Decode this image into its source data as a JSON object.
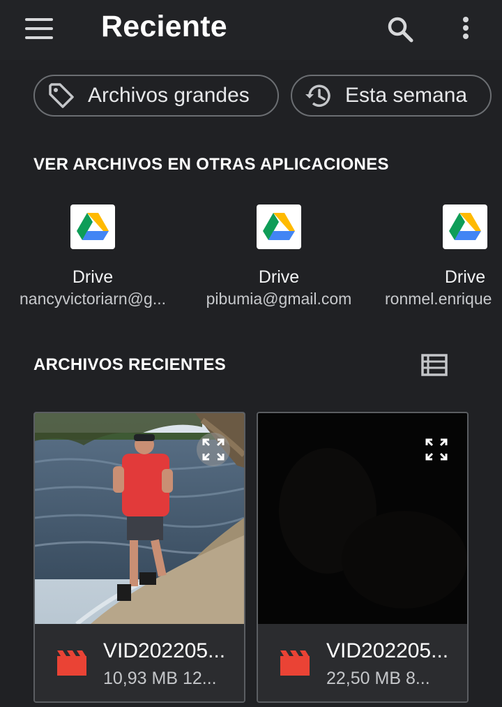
{
  "appbar": {
    "title": "Reciente",
    "menu_icon": "hamburger-menu-icon",
    "search_icon": "search-icon",
    "more_icon": "more-vertical-icon"
  },
  "chips": [
    {
      "label": "Archivos grandes",
      "icon": "tag-icon"
    },
    {
      "label": "Esta semana",
      "icon": "history-icon"
    }
  ],
  "apps_section": {
    "title": "VER ARCHIVOS EN OTRAS APLICACIONES",
    "apps": [
      {
        "name": "Drive",
        "account": "nancyvictoriarn@g...",
        "icon": "google-drive-icon"
      },
      {
        "name": "Drive",
        "account": "pibumia@gmail.com",
        "icon": "google-drive-icon"
      },
      {
        "name": "Drive",
        "account": "ronmel.enrique",
        "icon": "google-drive-icon"
      }
    ]
  },
  "recent_section": {
    "title": "ARCHIVOS RECIENTES",
    "view_toggle_icon": "list-view-icon"
  },
  "files": [
    {
      "name": "VID202205...",
      "meta": "10,93 MB 12...",
      "type_icon": "video-file-icon",
      "thumbnail": "man-exercising-on-lakeshore"
    },
    {
      "name": "VID202205...",
      "meta": "22,50 MB 8...",
      "type_icon": "video-file-icon",
      "thumbnail": "dark-frame"
    }
  ],
  "colors": {
    "background": "#202124",
    "video_icon": "#ea4335",
    "chip_border": "#6b6e72"
  }
}
